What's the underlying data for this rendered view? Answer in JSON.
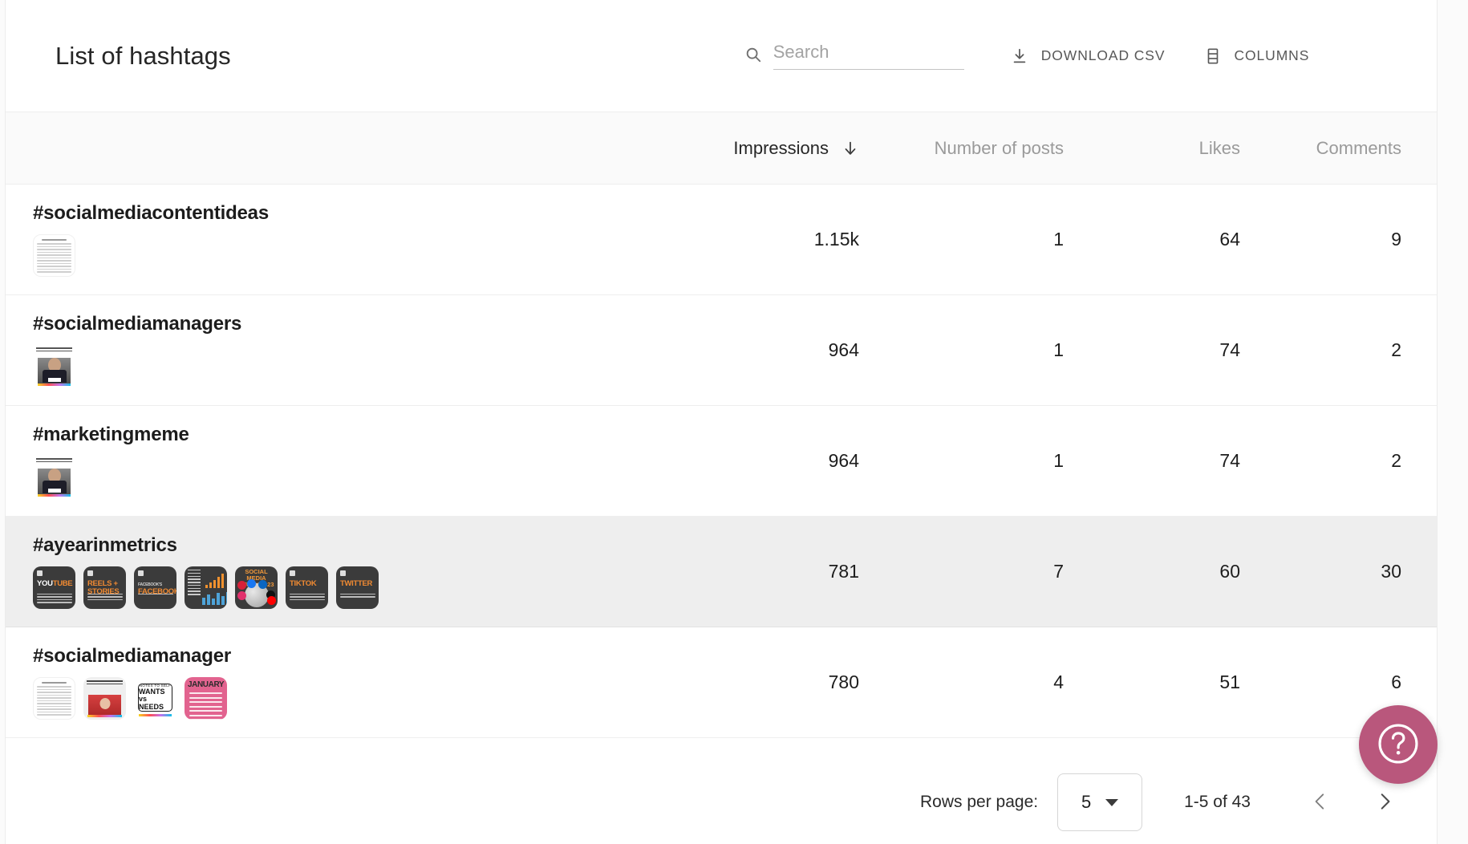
{
  "toolbar": {
    "title": "List of hashtags",
    "search_placeholder": "Search",
    "search_value": "",
    "download_label": "DOWNLOAD CSV",
    "columns_label": "COLUMNS",
    "search_icon": "search-icon",
    "download_icon": "download-icon",
    "columns_icon": "columns-icon"
  },
  "table": {
    "columns": [
      {
        "key": "name",
        "label": ""
      },
      {
        "key": "impressions",
        "label": "Impressions",
        "sorted": true,
        "sort_direction": "desc",
        "sort_icon": "arrow-downward-icon"
      },
      {
        "key": "posts",
        "label": "Number of posts"
      },
      {
        "key": "likes",
        "label": "Likes"
      },
      {
        "key": "comments",
        "label": "Comments"
      }
    ],
    "rows": [
      {
        "name": "#socialmediacontentideas",
        "impressions": "1.15k",
        "posts": "1",
        "likes": "64",
        "comments": "9",
        "selected": false,
        "thumbnails": [
          "doc-table"
        ]
      },
      {
        "name": "#socialmediamanagers",
        "impressions": "964",
        "posts": "1",
        "likes": "74",
        "comments": "2",
        "selected": false,
        "thumbnails": [
          "office-meme"
        ]
      },
      {
        "name": "#marketingmeme",
        "impressions": "964",
        "posts": "1",
        "likes": "74",
        "comments": "2",
        "selected": false,
        "thumbnails": [
          "office-meme"
        ]
      },
      {
        "name": "#ayearinmetrics",
        "impressions": "781",
        "posts": "7",
        "likes": "60",
        "comments": "30",
        "selected": true,
        "thumbnails": [
          "youtube-card",
          "reels-stories-card",
          "facebooks-card",
          "chart-card",
          "social-media-study-card",
          "tiktok-card",
          "twitter-card"
        ]
      },
      {
        "name": "#socialmediamanager",
        "impressions": "780",
        "posts": "4",
        "likes": "51",
        "comments": "6",
        "selected": false,
        "thumbnails": [
          "doc-table",
          "woman-photo",
          "wants-needs-card",
          "january-card"
        ]
      }
    ]
  },
  "thumbnail_text": {
    "youtube": {
      "brand": "YouTube",
      "brand_prefix": "",
      "sub_lines": 4
    },
    "reels": {
      "line1": "REELS +",
      "line2": "STORIES"
    },
    "facebooks": {
      "small": "Facebook's",
      "brand": "FACEBOOK'S"
    },
    "tiktok": {
      "brand": "TIKTOK"
    },
    "twitter": {
      "brand": "TWITTER"
    },
    "study": {
      "title": "SOCIAL MEDIA STUDY 2023"
    },
    "wants": {
      "top": "NOTES TO SELF",
      "line1": "WANTS",
      "line2": "vs NEEDS"
    },
    "january": {
      "title": "JANUARY"
    }
  },
  "footer": {
    "rows_per_page_label": "Rows per page:",
    "rows_per_page_value": "5",
    "range_label": "1-5 of 43",
    "prev_icon": "chevron-left-icon",
    "next_icon": "chevron-right-icon"
  },
  "help": {
    "label": "?",
    "icon": "help-circle-icon",
    "color": "#b9577c"
  },
  "colors": {
    "accent": "#b9577c",
    "row_selected_bg": "#eeeeee",
    "header_bg": "#fafafa",
    "text_primary": "#1c1c1c",
    "text_muted": "#9a9a9a"
  }
}
